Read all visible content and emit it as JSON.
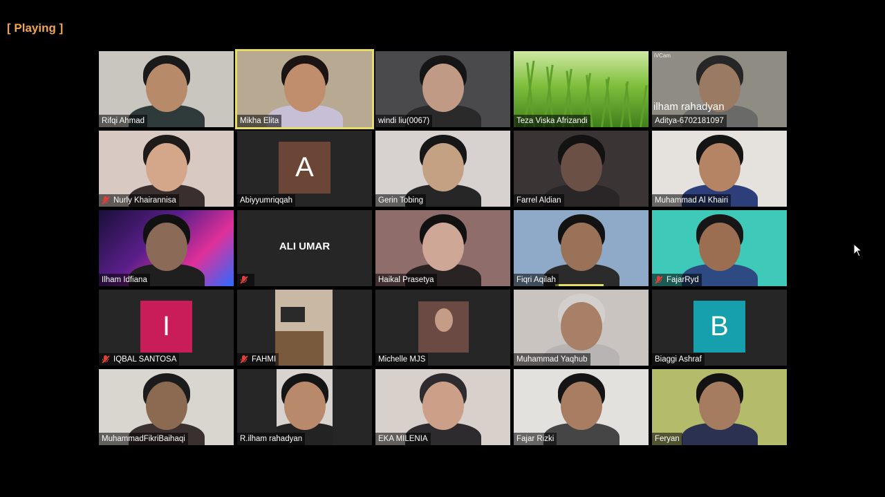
{
  "status": "[ Playing ]",
  "colors": {
    "active_border": "#e6dd64",
    "muted_mic": "#e0403a",
    "status_text": "#f2a54a"
  },
  "tiles": [
    {
      "name": "Rifqi Ahmad",
      "muted": false,
      "active": false,
      "bg": "#c9c5bf",
      "skin": "#b78a6a",
      "shirt": "#2f3b3a",
      "hair": "#1a1a1a"
    },
    {
      "name": "Mikha Elita",
      "muted": false,
      "active": true,
      "bg": "#b8aa92",
      "skin": "#c08d6d",
      "shirt": "#c7bfd6",
      "hair": "#1b1412"
    },
    {
      "name": "windi liu(0067)",
      "muted": false,
      "active": false,
      "bg": "#4a4a4c",
      "skin": "#c09a85",
      "shirt": "#2a2a2a",
      "hair": "#151515"
    },
    {
      "name": "Teza Viska Afrizandi",
      "muted": false,
      "active": false,
      "type": "grass"
    },
    {
      "name": "Aditya-6702181097",
      "muted": false,
      "active": false,
      "bg": "#8f8c83",
      "skin": "#9b7a63",
      "shirt": "#6a6a68",
      "hair": "#262626",
      "overlay": "ilham rahadyan",
      "tag": "iVCam"
    },
    {
      "name": "Nurly Khairannisa",
      "muted": true,
      "active": false,
      "bg": "#d8c9c3",
      "skin": "#d4a68a",
      "shirt": "#3a2f2f",
      "hair": "#1f1a1a"
    },
    {
      "name": "Abiyyumriqqah",
      "muted": false,
      "active": false,
      "type": "avatar",
      "letter": "A",
      "color": "#6b4636"
    },
    {
      "name": "Gerin Tobing",
      "muted": false,
      "active": false,
      "bg": "#d7d2cf",
      "skin": "#c5a184",
      "shirt": "#262626",
      "hair": "#161616"
    },
    {
      "name": "Farrel Aldian",
      "muted": false,
      "active": false,
      "bg": "#3a3435",
      "skin": "#6b5046",
      "shirt": "#2a2526",
      "hair": "#121212"
    },
    {
      "name": "Muhammad Al Khairi",
      "muted": false,
      "active": false,
      "bg": "#e5e2de",
      "skin": "#b48464",
      "shirt": "#2d3f7a",
      "hair": "#141414"
    },
    {
      "name": "Ilham Idfiana",
      "muted": false,
      "active": false,
      "bg": "#1b1446",
      "skin": "#8c6a58",
      "shirt": "#1f1f1f",
      "hair": "#111",
      "type": "neon"
    },
    {
      "name": "",
      "muted": true,
      "active": false,
      "type": "text",
      "label": "ALI UMAR"
    },
    {
      "name": "Haikal Prasetya",
      "muted": false,
      "active": false,
      "bg": "#8e6d6a",
      "skin": "#cfa796",
      "shirt": "#2a2324",
      "hair": "#111"
    },
    {
      "name": "Fiqri Aqilah",
      "muted": false,
      "active": false,
      "bg": "#8faac8",
      "skin": "#9a7257",
      "shirt": "#2b2b2b",
      "hair": "#121212",
      "speaking": true
    },
    {
      "name": "FajarRyd",
      "muted": true,
      "active": false,
      "bg": "#3fc9b9",
      "skin": "#9c6e51",
      "shirt": "#2d4a82",
      "hair": "#161616"
    },
    {
      "name": "IQBAL SANTOSA",
      "muted": true,
      "active": false,
      "type": "avatar",
      "letter": "I",
      "color": "#c81d58"
    },
    {
      "name": "FAHMI",
      "muted": true,
      "active": false,
      "type": "desk"
    },
    {
      "name": "Michelle MJS",
      "muted": false,
      "active": false,
      "type": "small"
    },
    {
      "name": "Muhammad Yaqhub",
      "muted": false,
      "active": false,
      "bg": "#c9c4c0",
      "skin": "#a88068",
      "shirt": "#b8b4b3",
      "hair": "#d2cfcd"
    },
    {
      "name": "Biaggi Ashraf",
      "muted": false,
      "active": false,
      "type": "avatar",
      "letter": "B",
      "color": "#16a0ad"
    },
    {
      "name": "MuhammadFikriBaihaqi",
      "muted": false,
      "active": false,
      "bg": "#d8d6cf",
      "skin": "#8c6a52",
      "shirt": "#3a3030",
      "hair": "#1b1b1b"
    },
    {
      "name": "R.ilham rahadyan",
      "muted": false,
      "active": false,
      "type": "portrait",
      "bg": "#d8d3cf",
      "skin": "#b8896b",
      "shirt": "#232323",
      "hair": "#151515"
    },
    {
      "name": "EKA MILENIA",
      "muted": false,
      "active": false,
      "bg": "#d8d0cb",
      "skin": "#cca088",
      "shirt": "#2d2b2e",
      "hair": "#2d2b2e"
    },
    {
      "name": "Fajar Rizki",
      "muted": false,
      "active": false,
      "bg": "#e3e1de",
      "skin": "#a97d62",
      "shirt": "#454545",
      "hair": "#141414"
    },
    {
      "name": "Feryan",
      "muted": false,
      "active": false,
      "bg": "#b4bb6a",
      "skin": "#a67c60",
      "shirt": "#2b3150",
      "hair": "#121212"
    }
  ]
}
